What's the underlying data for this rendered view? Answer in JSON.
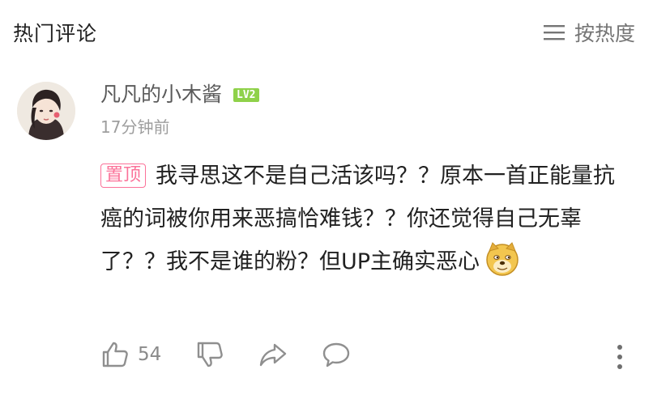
{
  "header": {
    "title": "热门评论",
    "sort_label": "按热度"
  },
  "comment": {
    "username": "凡凡的小木酱",
    "level": "LV2",
    "timestamp": "17分钟前",
    "pin_label": "置顶",
    "text": "我寻思这不是自己活该吗？？原本一首正能量抗癌的词被你用来恶搞恰难钱？？你还觉得自己无辜了？？我不是谁的粉？但UP主确实恶心",
    "emoji": "doge-emoji",
    "like_count": "54"
  },
  "colors": {
    "accent_pink": "#fb7299",
    "level_green": "#8fd14a",
    "muted": "#9e9e9e"
  }
}
